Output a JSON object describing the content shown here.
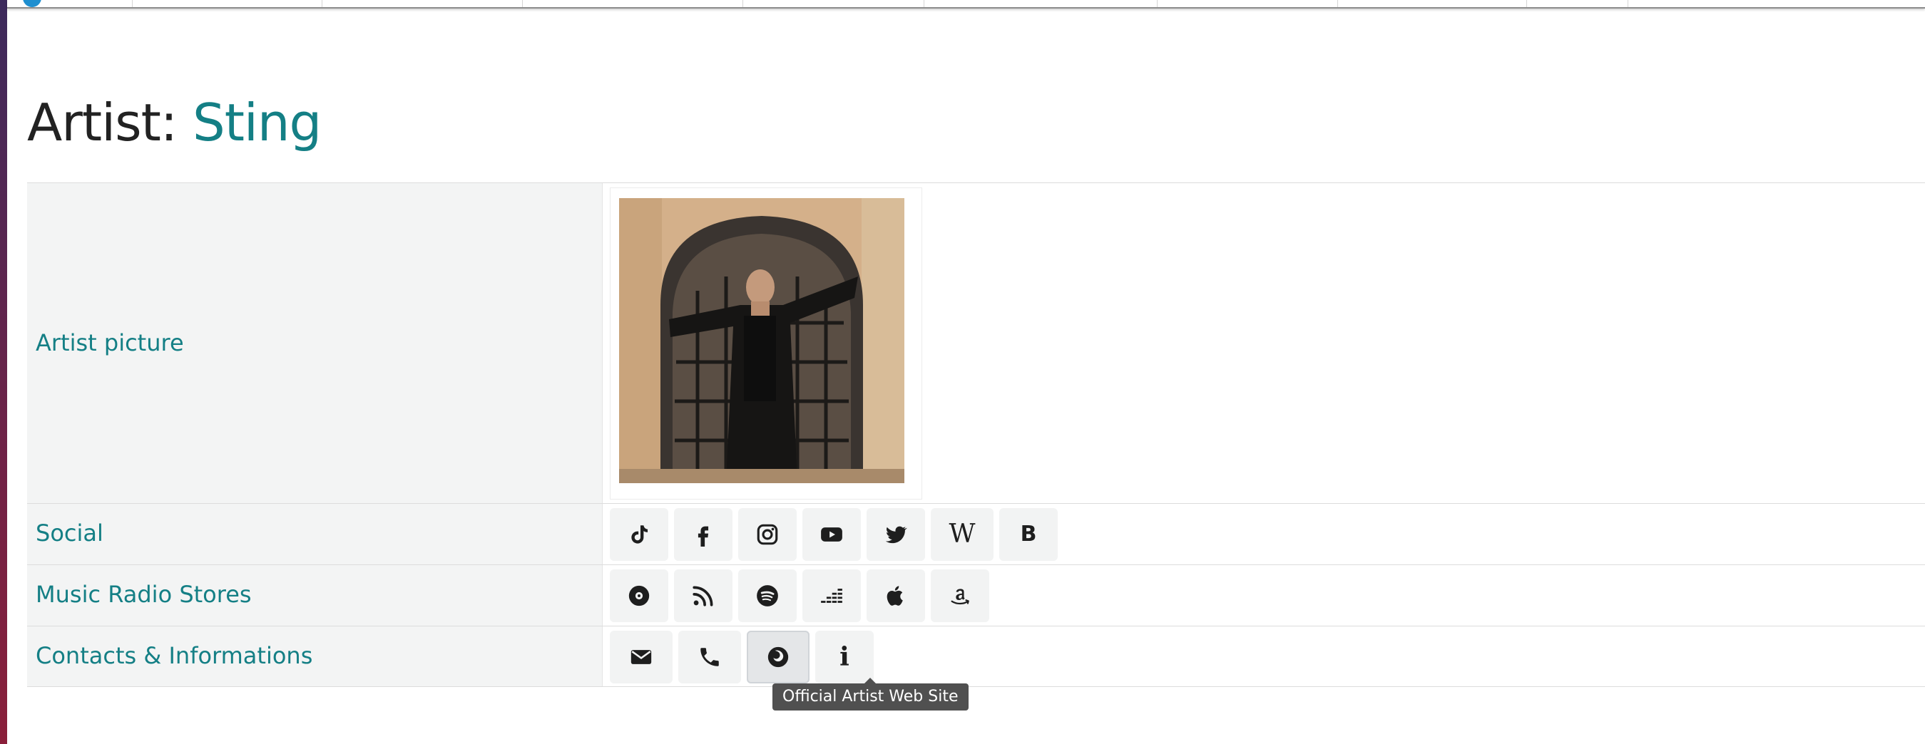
{
  "page": {
    "title_prefix": "Artist: ",
    "artist_name": "Sting"
  },
  "rows": {
    "picture_label": "Artist picture",
    "social_label": "Social",
    "music_label": "Music Radio Stores",
    "contacts_label": "Contacts & Informations"
  },
  "social_icons": [
    "tiktok-icon",
    "facebook-icon",
    "instagram-icon",
    "youtube-icon",
    "twitter-icon",
    "wikipedia-icon",
    "bandsintown-icon"
  ],
  "social_glyphs": {
    "wikipedia": "W",
    "bandsintown": "B"
  },
  "music_icons": [
    "vinyl-record-icon",
    "rss-podcast-icon",
    "spotify-icon",
    "deezer-icon",
    "apple-icon",
    "amazon-icon"
  ],
  "contact_icons": [
    "email-icon",
    "phone-icon",
    "website-icon",
    "info-icon"
  ],
  "contact_glyphs": {
    "info": "i"
  },
  "tooltip": {
    "text": "Official Artist Web Site"
  },
  "colors": {
    "accent": "#147f85",
    "label_bg": "#f3f4f4",
    "icon_bg": "#f2f3f3",
    "tooltip_bg": "#505050"
  }
}
